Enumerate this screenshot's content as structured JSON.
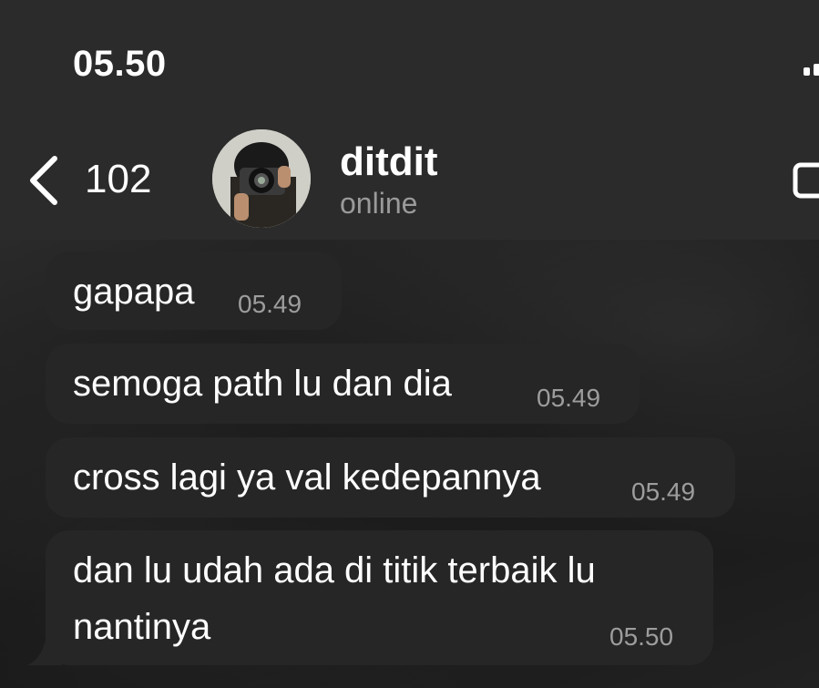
{
  "status_bar": {
    "time": "05.50"
  },
  "header": {
    "back_count": "102",
    "contact_name": "ditdit",
    "contact_status": "online"
  },
  "messages": [
    {
      "text": "gapapa",
      "time": "05.49"
    },
    {
      "text": "semoga path lu dan dia",
      "time": "05.49"
    },
    {
      "text": "cross lagi ya val kedepannya",
      "time": "05.49"
    },
    {
      "lines": [
        "dan lu udah ada di titik terbaik lu",
        "nantinya"
      ],
      "time": "05.50"
    }
  ],
  "colors": {
    "header_bg": "#2b2b2b",
    "bubble_bg": "#262626",
    "timestamp": "#9d9d9d",
    "status_gray": "#9a9a9a"
  }
}
